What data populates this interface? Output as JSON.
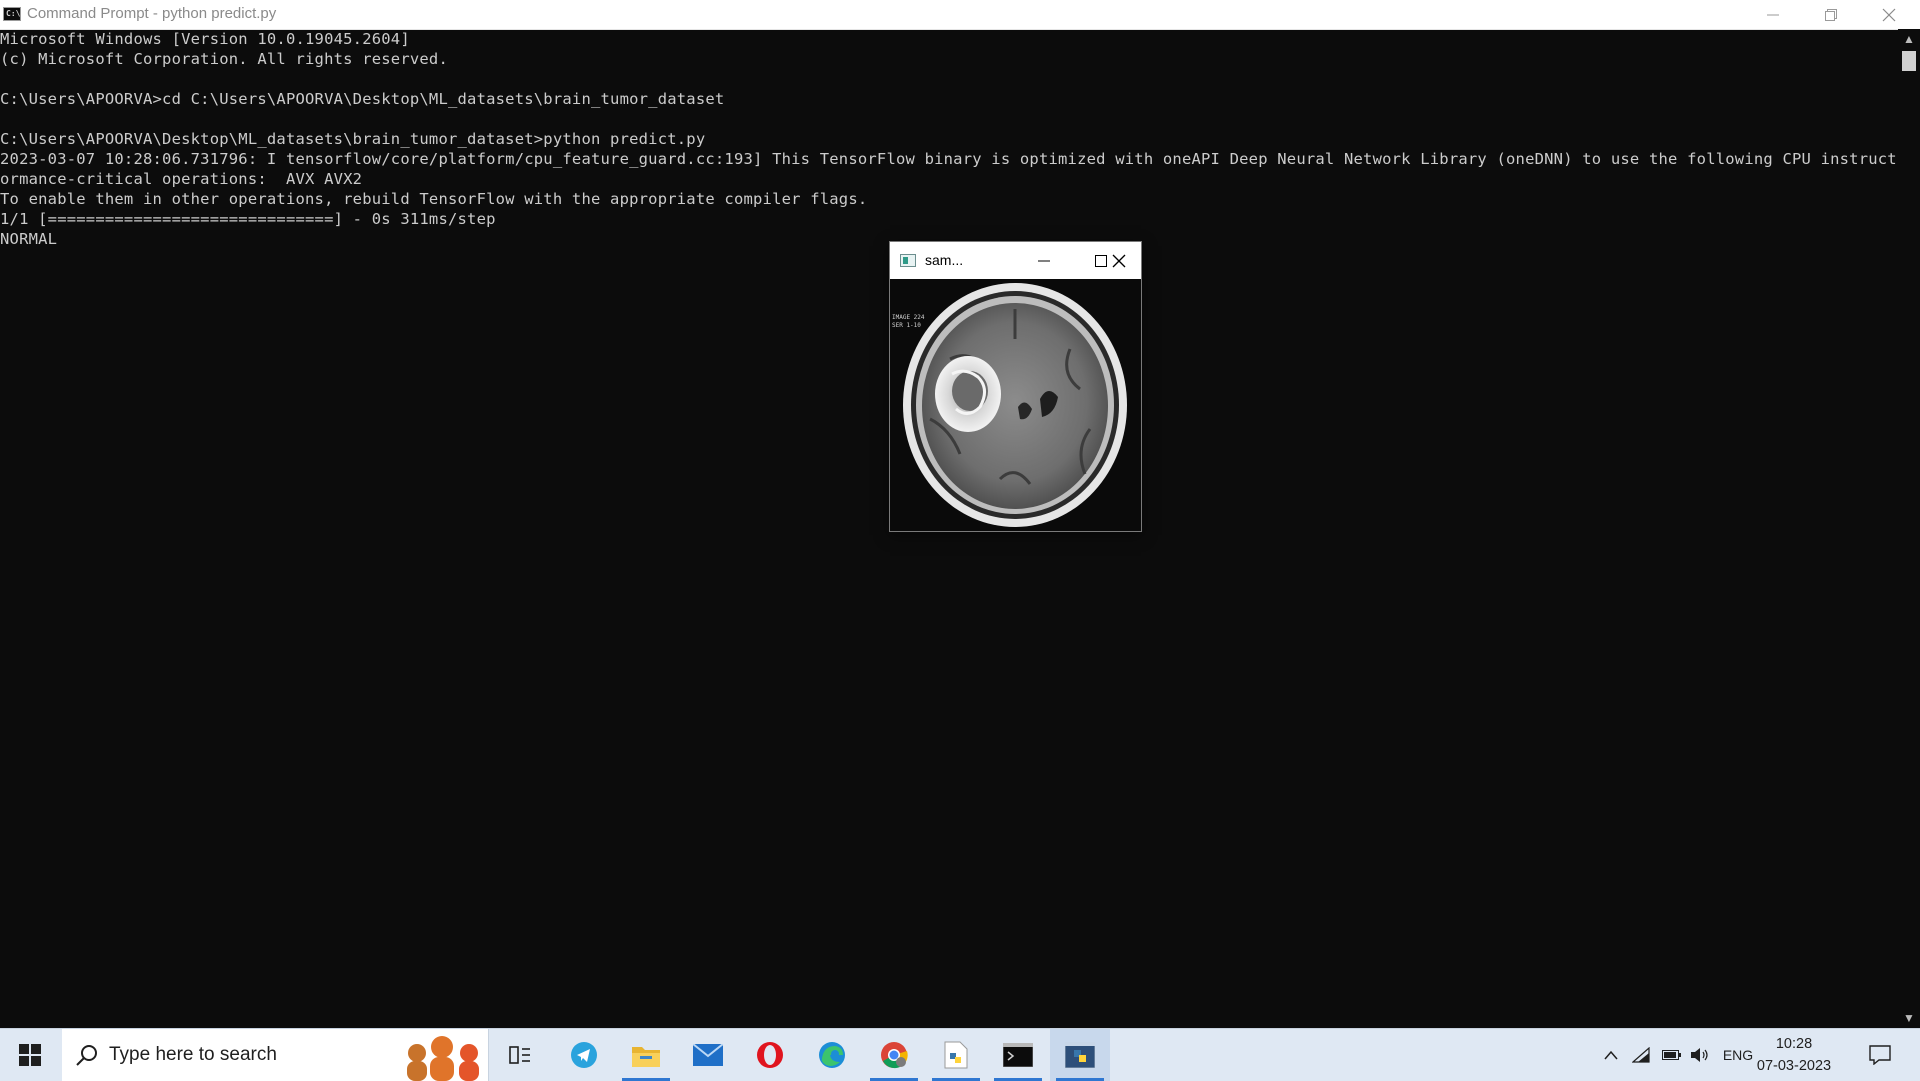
{
  "window": {
    "title": "Command Prompt - python  predict.py",
    "icon_text": "C:\\"
  },
  "console": {
    "lines": [
      "Microsoft Windows [Version 10.0.19045.2604]",
      "(c) Microsoft Corporation. All rights reserved.",
      "",
      "C:\\Users\\APOORVA>cd C:\\Users\\APOORVA\\Desktop\\ML_datasets\\brain_tumor_dataset",
      "",
      "C:\\Users\\APOORVA\\Desktop\\ML_datasets\\brain_tumor_dataset>python predict.py",
      "2023-03-07 10:28:06.731796: I tensorflow/core/platform/cpu_feature_guard.cc:193] This TensorFlow binary is optimized with oneAPI Deep Neural Network Library (oneDNN) to use the following CPU instructions in perf",
      "ormance-critical operations:  AVX AVX2",
      "To enable them in other operations, rebuild TensorFlow with the appropriate compiler flags.",
      "1/1 [==============================] - 0s 311ms/step",
      "NORMAL"
    ]
  },
  "image_window": {
    "title": "sam..."
  },
  "taskbar": {
    "search_placeholder": "Type here to search",
    "apps": [
      "task-view",
      "telegram",
      "file-explorer",
      "mail",
      "opera",
      "edge",
      "chrome",
      "python-launcher",
      "command-prompt",
      "python"
    ],
    "tray": {
      "language": "ENG",
      "time": "10:28",
      "date": "07-03-2023"
    }
  },
  "colors": {
    "console_bg": "#0c0c0c",
    "console_fg": "#cccccc",
    "taskbar_bg": "#dfe8f3",
    "accent": "#2f77d1"
  }
}
